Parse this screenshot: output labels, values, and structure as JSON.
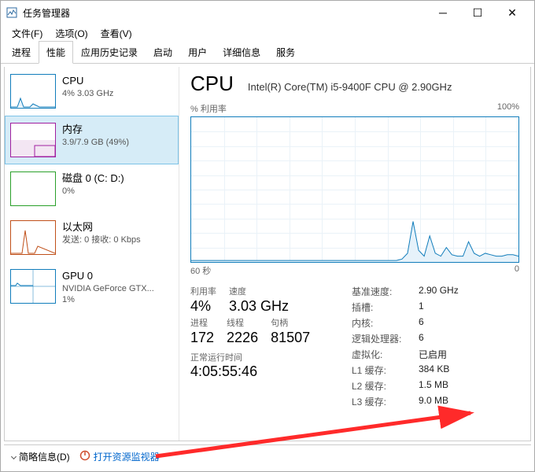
{
  "window": {
    "title": "任务管理器"
  },
  "menu": {
    "file": "文件(F)",
    "options": "选项(O)",
    "view": "查看(V)"
  },
  "tabs": [
    "进程",
    "性能",
    "应用历史记录",
    "启动",
    "用户",
    "详细信息",
    "服务"
  ],
  "active_tab": 1,
  "sidebar": [
    {
      "title": "CPU",
      "sub": "4% 3.03 GHz",
      "kind": "cpu"
    },
    {
      "title": "内存",
      "sub": "3.9/7.9 GB (49%)",
      "kind": "mem"
    },
    {
      "title": "磁盘 0 (C: D:)",
      "sub": "0%",
      "kind": "disk"
    },
    {
      "title": "以太网",
      "sub": "发送: 0 接收: 0 Kbps",
      "kind": "eth"
    },
    {
      "title": "GPU 0",
      "sub": "NVIDIA GeForce GTX...\n1%",
      "kind": "gpu"
    }
  ],
  "selected_sidebar": 1,
  "detail": {
    "heading": "CPU",
    "model": "Intel(R) Core(TM) i5-9400F CPU @ 2.90GHz",
    "axis_top_left": "% 利用率",
    "axis_top_right": "100%",
    "axis_bot_left": "60 秒",
    "axis_bot_right": "0",
    "stats": {
      "util_lbl": "利用率",
      "util_val": "4%",
      "speed_lbl": "速度",
      "speed_val": "3.03 GHz",
      "proc_lbl": "进程",
      "proc_val": "172",
      "thread_lbl": "线程",
      "thread_val": "2226",
      "handle_lbl": "句柄",
      "handle_val": "81507",
      "uptime_lbl": "正常运行时间",
      "uptime_val": "4:05:55:46"
    },
    "info": [
      {
        "lbl": "基准速度:",
        "val": "2.90 GHz"
      },
      {
        "lbl": "插槽:",
        "val": "1"
      },
      {
        "lbl": "内核:",
        "val": "6"
      },
      {
        "lbl": "逻辑处理器:",
        "val": "6"
      },
      {
        "lbl": "虚拟化:",
        "val": "已启用"
      },
      {
        "lbl": "L1 缓存:",
        "val": "384 KB"
      },
      {
        "lbl": "L2 缓存:",
        "val": "1.5 MB"
      },
      {
        "lbl": "L3 缓存:",
        "val": "9.0 MB"
      }
    ]
  },
  "footer": {
    "fewer": "简略信息(D)",
    "resmon": "打开资源监视器"
  },
  "chart_data": {
    "type": "line",
    "title": "% 利用率",
    "ylim": [
      0,
      100
    ],
    "xlabel_left": "60 秒",
    "xlabel_right": "0",
    "x": [
      0,
      1,
      2,
      3,
      4,
      5,
      6,
      7,
      8,
      9,
      10,
      11,
      12,
      13,
      14,
      15,
      16,
      17,
      18,
      19,
      20,
      21,
      22,
      23,
      24,
      25,
      26,
      27,
      28,
      29,
      30,
      31,
      32,
      33,
      34,
      35,
      36,
      37,
      38,
      39,
      40,
      41,
      42,
      43,
      44,
      45,
      46,
      47,
      48,
      49,
      50,
      51,
      52,
      53,
      54,
      55,
      56,
      57,
      58,
      59
    ],
    "values": [
      1,
      1,
      1,
      1,
      1,
      1,
      1,
      1,
      1,
      1,
      1,
      1,
      1,
      1,
      1,
      1,
      1,
      1,
      1,
      1,
      1,
      1,
      1,
      1,
      1,
      1,
      1,
      1,
      1,
      1,
      1,
      1,
      1,
      1,
      1,
      1,
      1,
      1,
      2,
      6,
      28,
      8,
      4,
      18,
      6,
      4,
      10,
      5,
      4,
      4,
      14,
      6,
      4,
      6,
      5,
      4,
      4,
      5,
      5,
      4
    ]
  }
}
